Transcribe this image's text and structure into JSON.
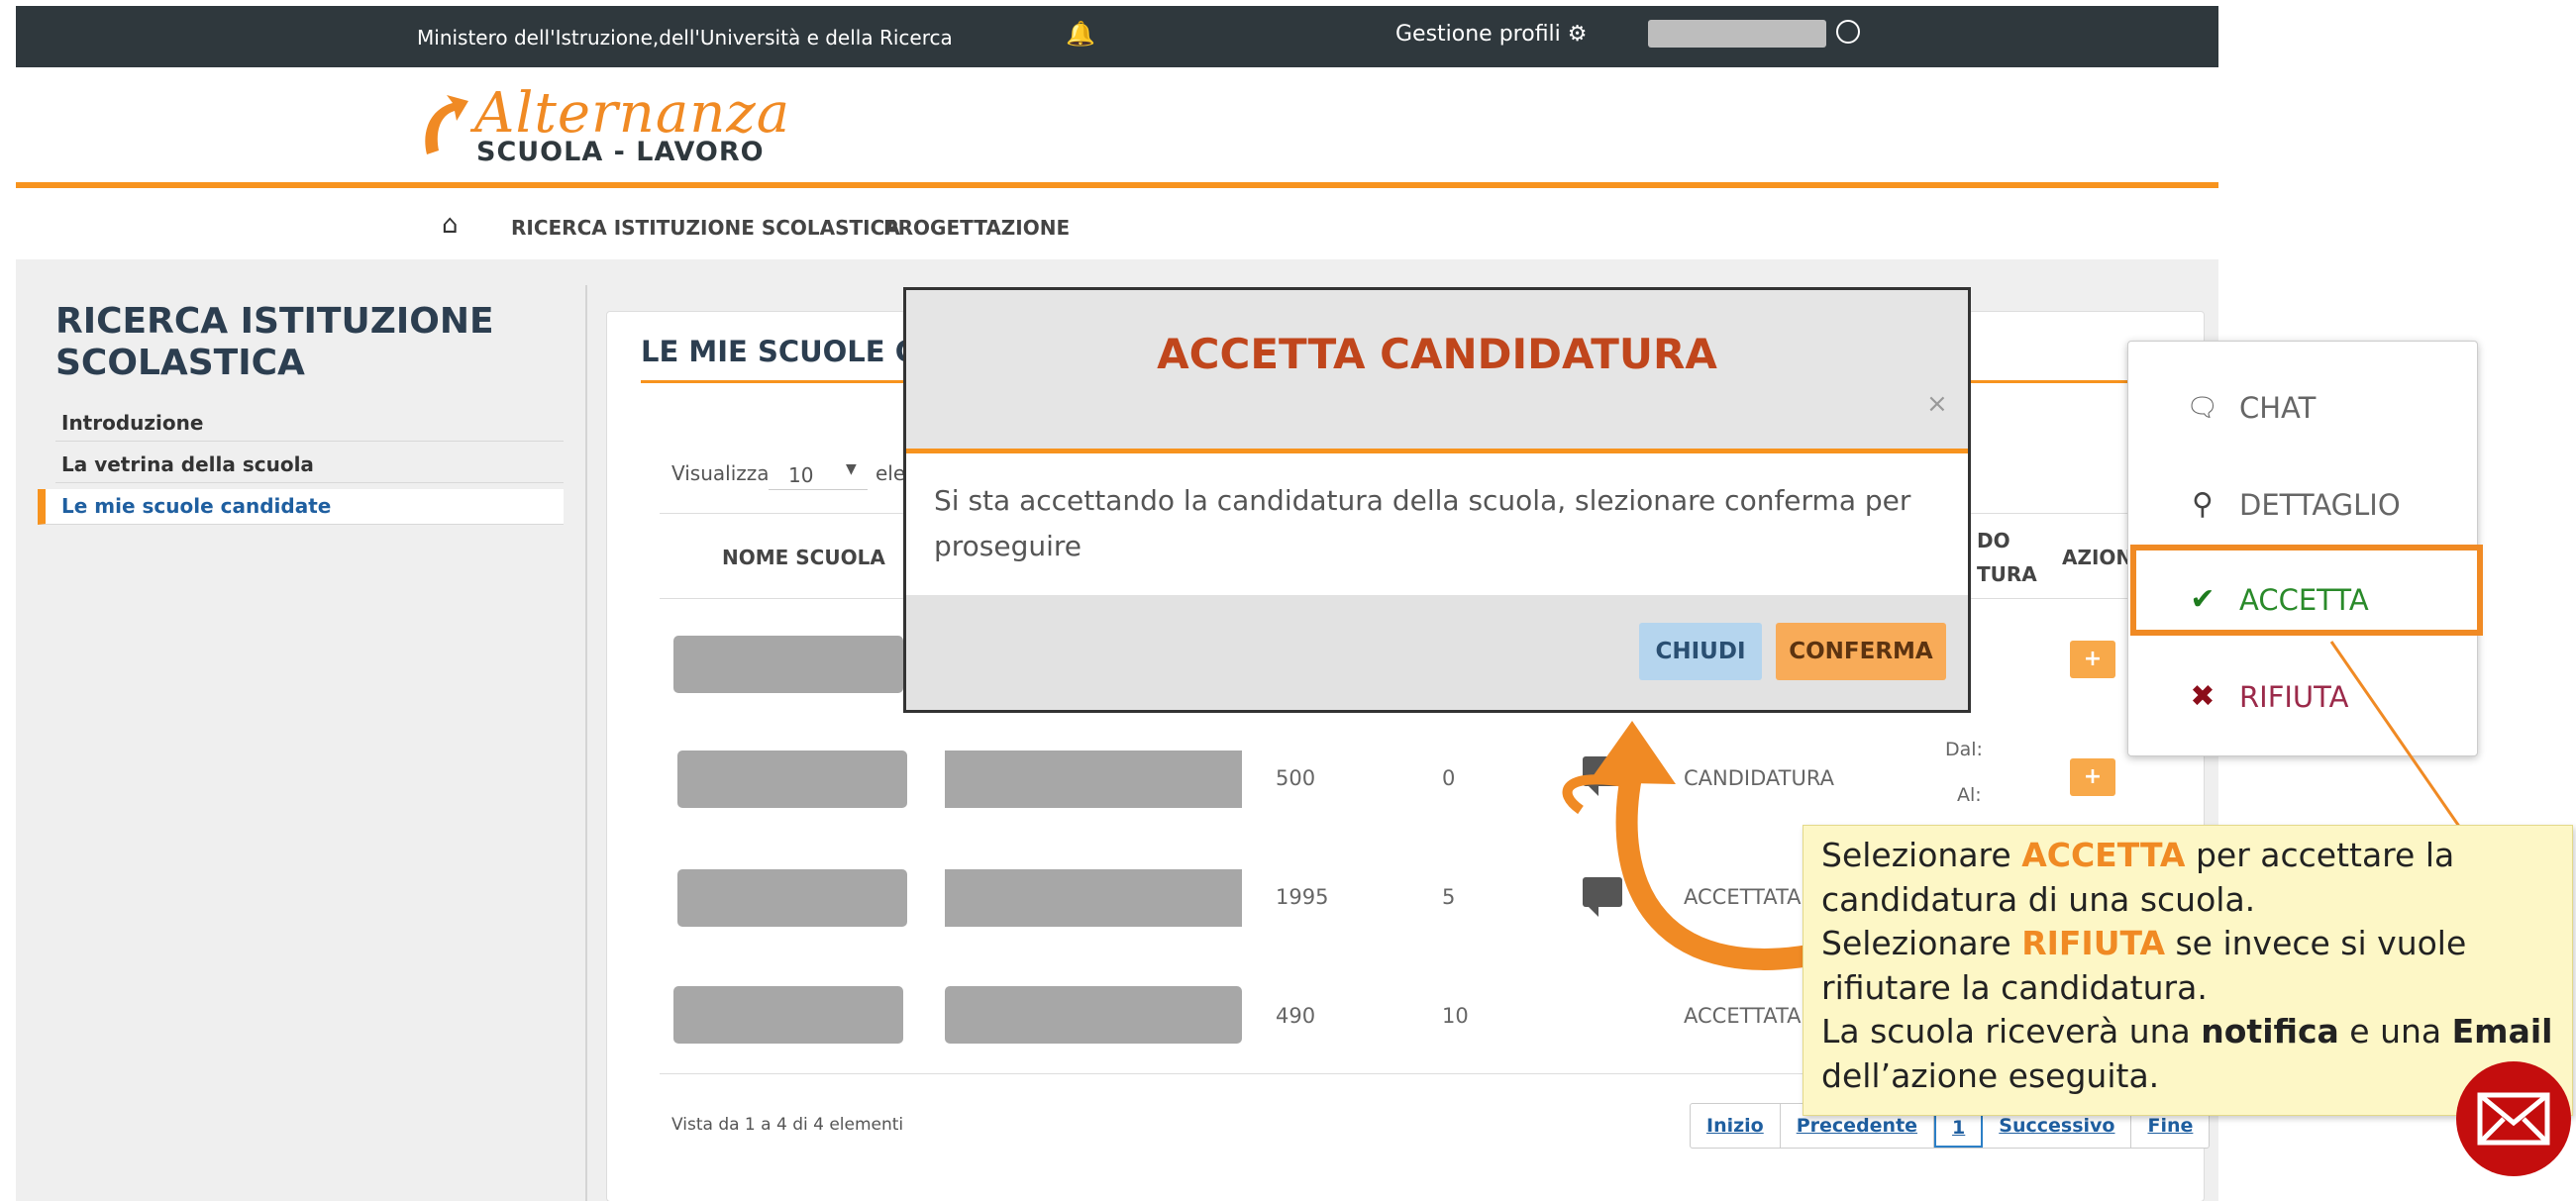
{
  "topbar": {
    "ministry": "Ministero dell'Istruzione,dell'Università e della Ricerca",
    "profiles_label": "Gestione profili"
  },
  "logo": {
    "script": "Alternanza",
    "sub": "SCUOLA - LAVORO"
  },
  "nav": {
    "items": [
      "RICERCA ISTITUZIONE SCOLASTICA",
      "PROGETTAZIONE"
    ]
  },
  "sidebar": {
    "title": "RICERCA ISTITUZIONE SCOLASTICA",
    "items": [
      "Introduzione",
      "La vetrina della scuola",
      "Le mie scuole candidate"
    ]
  },
  "main": {
    "title": "LE MIE SCUOLE CA",
    "show_label": "Visualizza",
    "show_value": "10",
    "show_suffix": "ele",
    "headers": {
      "name": "NOME SCUOLA",
      "period_1": "DO",
      "period_2": "TURA",
      "actions": "AZION"
    },
    "rows": [
      {
        "students": "500",
        "count": "0",
        "state": "CANDIDATURA",
        "dal": "Dal:",
        "al": "Al:"
      },
      {
        "students": "1995",
        "count": "5",
        "state": "ACCETTATA"
      },
      {
        "students": "490",
        "count": "10",
        "state": "ACCETTATA"
      }
    ],
    "footer_info": "Vista da 1 a 4 di 4 elementi",
    "pager": [
      "Inizio",
      "Precedente",
      "1",
      "Successivo",
      "Fine"
    ]
  },
  "modal": {
    "title": "ACCETTA CANDIDATURA",
    "close": "×",
    "body": "Si sta accettando la candidatura della scuola, slezionare conferma per proseguire",
    "btn_close": "CHIUDI",
    "btn_confirm": "CONFERMA"
  },
  "menu": {
    "items": [
      "CHAT",
      "DETTAGLIO",
      "ACCETTA",
      "RIFIUTA"
    ]
  },
  "callout": {
    "t1": "Selezionare ",
    "accetta": "ACCETTA",
    "t2": " per accettare la candidatura di una scuola.",
    "t3": "Selezionare ",
    "rifiuta": "RIFIUTA",
    "t4": " se invece si vuole rifiutare la candidatura.",
    "t5": "La scuola riceverà una ",
    "notifica": "notifica",
    "t6": " e una ",
    "email": "Email",
    "t7": " dell’azione eseguita."
  },
  "colors": {
    "accent": "#f7931e",
    "topbar": "#2f383d",
    "modal_title": "#c0461c",
    "callout_bg": "#fdf7c6",
    "mail": "#c40d0d"
  }
}
